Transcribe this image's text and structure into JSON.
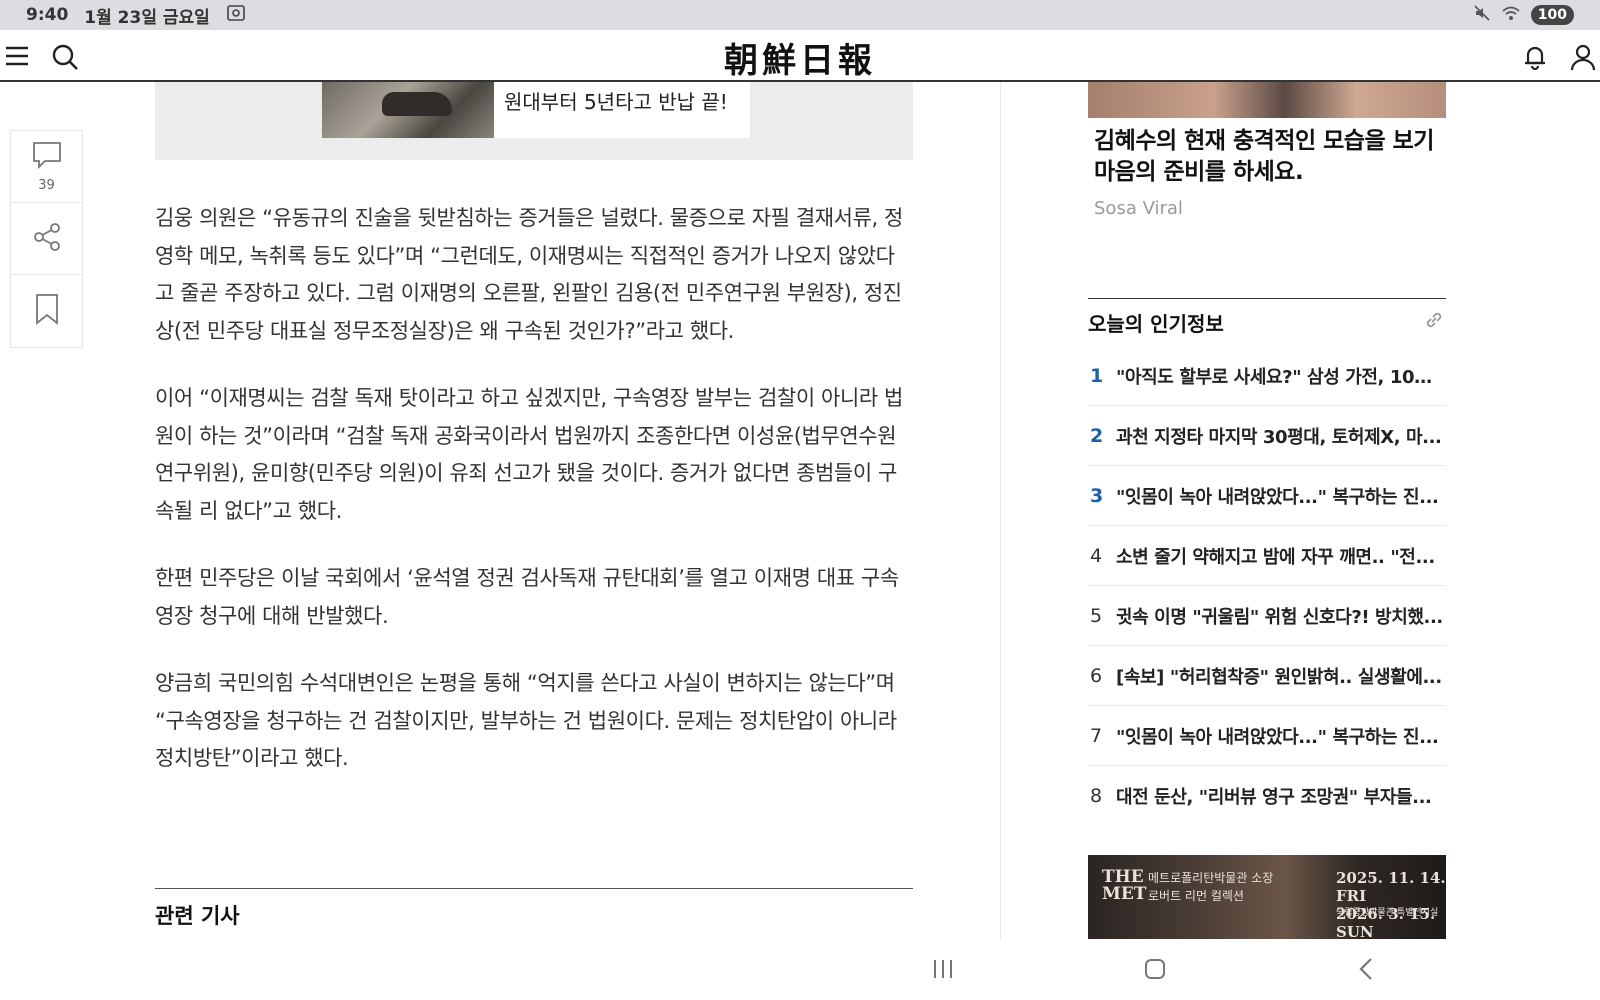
{
  "status": {
    "time": "9:40",
    "date": "1월 23일 금요일",
    "battery": "100"
  },
  "header": {
    "logo": "朝鮮日報"
  },
  "tools": {
    "comment_count": "39"
  },
  "ad_top": {
    "text": "원대부터 5년타고 반납 끝!"
  },
  "article": {
    "paragraphs": [
      "김웅 의원은 “유동규의 진술을 뒷받침하는 증거들은 널렸다. 물증으로 자필 결재서류, 정영학 메모, 녹취록 등도 있다”며 “그런데도, 이재명씨는 직접적인 증거가 나오지 않았다고 줄곧 주장하고 있다. 그럼 이재명의 오른팔, 왼팔인 김용(전 민주연구원 부원장), 정진상(전 민주당 대표실 정무조정실장)은 왜 구속된 것인가?”라고 했다.",
      "이어 “이재명씨는 검찰 독재 탓이라고 하고 싶겠지만, 구속영장 발부는 검찰이 아니라 법원이 하는 것”이라며 “검찰 독재 공화국이라서 법원까지 조종한다면 이성윤(법무연수원 연구위원), 윤미향(민주당 의원)이 유죄 선고가 됐을 것이다. 증거가 없다면 종범들이 구속될 리 없다”고 했다.",
      "한편 민주당은 이날 국회에서 ‘윤석열 정권 검사독재 규탄대회’를 열고 이재명 대표 구속영장 청구에 대해 반발했다.",
      "양금희 국민의힘 수석대변인은 논평을 통해 “억지를 쓴다고 사실이 변하지는 않는다”며 “구속영장을 청구하는 건 검찰이지만, 발부하는 건 법원이다. 문제는 정치탄압이 아니라 정치방탄”이라고 했다."
    ],
    "related_title": "관련 기사"
  },
  "sidebar": {
    "promo_title": "김혜수의 현재 충격적인 모습을 보기 마음의 준비를 하세요.",
    "promo_source": "Sosa Viral",
    "popular_title": "오늘의 인기정보",
    "popular": [
      {
        "rank": "1",
        "text": "\"아직도 할부로 사세요?\" 삼성 가전, 100..."
      },
      {
        "rank": "2",
        "text": "과천 지정타 마지막 30평대, 토허제X, 마..."
      },
      {
        "rank": "3",
        "text": "\"잇몸이 녹아 내려앉았다...\" 복구하는 진..."
      },
      {
        "rank": "4",
        "text": "소변 줄기 약해지고 밤에 자꾸 깨면.. \"전..."
      },
      {
        "rank": "5",
        "text": "귓속 이명 \"귀울림\" 위험 신호다?! 방치했..."
      },
      {
        "rank": "6",
        "text": "[속보] \"허리협착증\" 원인밝혀.. 실생활에..."
      },
      {
        "rank": "7",
        "text": "\"잇몸이 녹아 내려앉았다...\" 복구하는 진..."
      },
      {
        "rank": "8",
        "text": "대전 둔산, \"리버뷰 영구 조망권\" 부자들..."
      }
    ],
    "met_ad": {
      "logo": "THE MET",
      "line1": "메트로폴리탄박물관 소장",
      "line2": "로버트 리먼 컬렉션",
      "date1": "2025. 11. 14. FRI",
      "date2": "2026. 3. 15. SUN",
      "venue": "국립중앙박물관 특별전시실"
    }
  }
}
